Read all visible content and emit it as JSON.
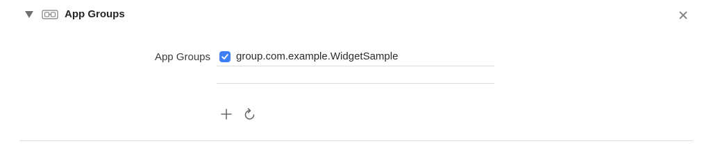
{
  "capability": {
    "title": "App Groups",
    "icon": "app-groups-icon",
    "expanded": true
  },
  "app_groups_field": {
    "label": "App Groups",
    "groups": [
      {
        "name": "group.com.example.WidgetSample",
        "checked": true
      }
    ]
  },
  "colors": {
    "checkbox_accent": "#3d7ff5",
    "divider": "#dcdcdc"
  },
  "icons": {
    "disclosure": "disclosure-triangle-icon",
    "close": "close-icon",
    "add": "plus-icon",
    "refresh": "refresh-icon"
  }
}
